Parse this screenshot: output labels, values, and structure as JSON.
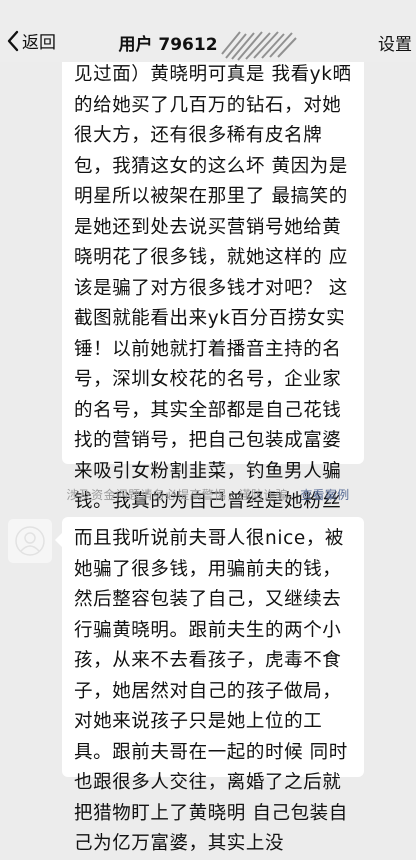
{
  "nav": {
    "back_label": "返回",
    "title": "用户 79612",
    "settings_label": "设置"
  },
  "messages": [
    {
      "text": "见过面）黄晓明可真是            我看yk晒的给她买了几百万的钻石，对她很大方，还有很多稀有皮名牌包，我猜这女的这么坏 黄因为是明星所以被架在那里了 最搞笑的是她还到处去说买营销号她给黄晓明花了很多钱，就她这样的 应该是骗了对方很多钱才对吧？ 这截图就能看出来yk百分百捞女实锤！以前她就打着播音主持的名号，深圳女校花的名号，企业家的名号，其实全部都是自己花钱找的营销号，把自己包装成富婆来吸引女粉割韭菜，钓鱼男人骗钱。我真的为自己曾经是她粉丝感到可耻，实在是忍不了看她越骗越多，越骗越大，害更多的人"
    },
    {
      "text": "而且我听说前夫哥人很nice，被她骗了很多钱，用骗前夫的钱，然后整容包装了自己，又继续去行骗黄晓明。跟前夫生的两个小孩，从来不去看孩子，虎毒不食子，她居然对自己的孩子做局，对她来说孩子只是她上位的工具。跟前夫哥在一起的时候 同时也跟很多人交往，离婚了之后就把猎物盯上了黄晓明 自己包装自己为亿万富婆，其实上没"
    }
  ],
  "notice": {
    "text": "涉及资金问题请务必提高警惕，谨防诈骗。",
    "link": "查看案例"
  },
  "icons": {
    "back": "chevron-left-icon",
    "avatar": "default-avatar-icon"
  }
}
